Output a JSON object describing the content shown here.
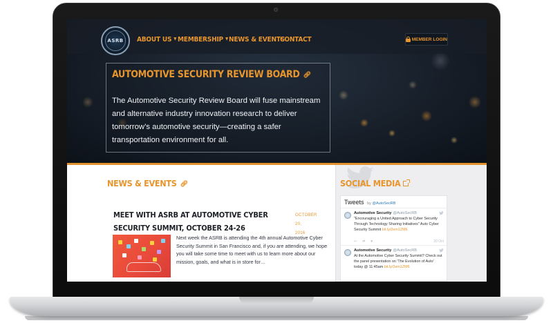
{
  "nav": {
    "logo_text": "ASRB",
    "items": [
      {
        "label": "ABOUT US",
        "dropdown": true
      },
      {
        "label": "MEMBERSHIP",
        "dropdown": true
      },
      {
        "label": "NEWS & EVENTS",
        "dropdown": false
      },
      {
        "label": "CONTACT",
        "dropdown": false
      }
    ],
    "member_login": "MEMBER LOGIN"
  },
  "hero": {
    "title": "AUTOMOTIVE SECURITY REVIEW BOARD",
    "text": "The Automotive Security Review Board will fuse mainstream and alternative industry innovation research to deliver tomorrow’s automotive security—creating a safer transportation environment for all."
  },
  "news": {
    "section_title": "NEWS & EVENTS",
    "post": {
      "title": "MEET WITH ASRB AT AUTOMOTIVE CYBER SECURITY SUMMIT, OCTOBER 24-26",
      "date_line1": "OCTOBER 20,",
      "date_line2": "2016",
      "excerpt": "Next week the ASRB is attending the 4th annual Automotive Cyber Security Summit in San Francisco and, if you are attending, we hope you will take some time to meet with us to learn more about our mission, goals, and what is in store for…"
    }
  },
  "social": {
    "section_title": "SOCIAL MEDIA",
    "tweets_heading": "Tweets",
    "by_label": "by",
    "by_handle": "@AutoSecRB",
    "tweets": [
      {
        "name": "Automotive Security",
        "handle": "@AutoSecRB",
        "text": "\"Encouraging a United Approach to Cyber Security Through Technology Sharing Initiatives\" Auto Cyber Security Summit",
        "link": "bit.ly/2em1ZM6",
        "time": "20 Oct"
      },
      {
        "name": "Automotive Security",
        "handle": "@AutoSecRB",
        "text": "At the Automotive Cyber Security Summit? Check out the panel presentation on 'The Evolution of Auto' today @ 11:45am",
        "link": "bit.ly/2em1ZM6",
        "time": ""
      }
    ]
  },
  "colors": {
    "accent": "#e8952d",
    "nav_bg": "#181e27",
    "sidebar_bg": "#eeeef0",
    "twitter_blue": "#2b7bb9"
  }
}
